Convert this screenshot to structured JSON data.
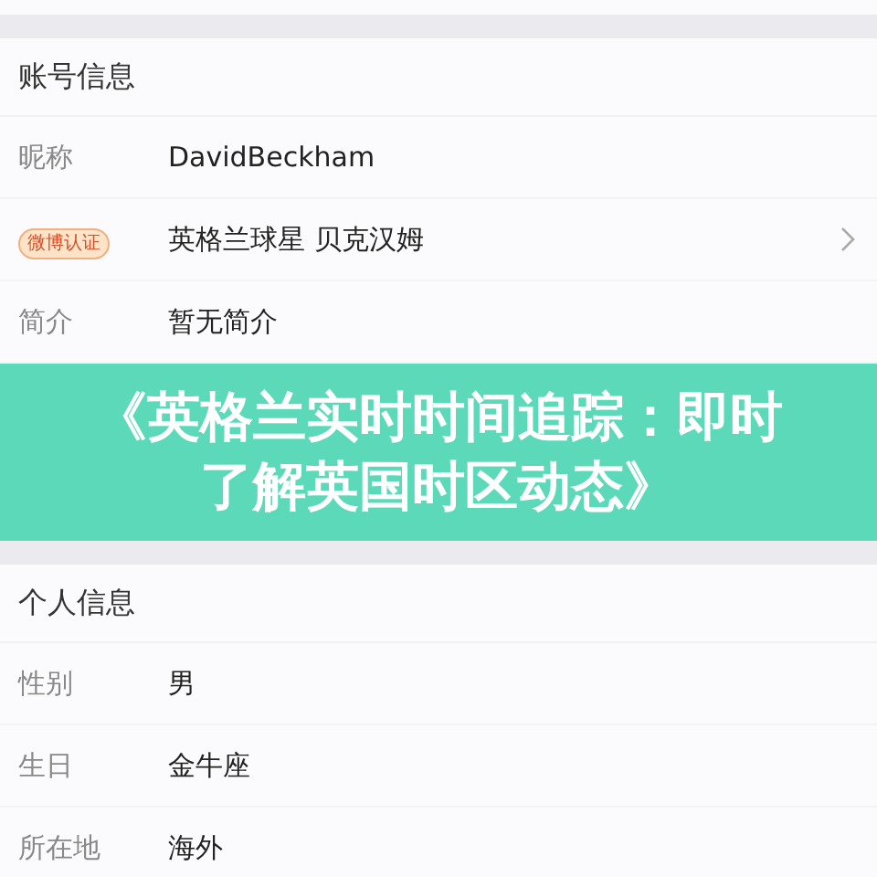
{
  "sections": [
    {
      "title": "账号信息",
      "rows": [
        {
          "label": "昵称",
          "kind": "text",
          "value": "DavidBeckham",
          "chevron": false
        },
        {
          "label": "微博认证",
          "kind": "badge",
          "value": "英格兰球星 贝克汉姆",
          "chevron": true
        },
        {
          "label": "简介",
          "kind": "text",
          "value": "暂无简介",
          "chevron": false
        }
      ]
    },
    {
      "title": "个人信息",
      "rows": [
        {
          "label": "性别",
          "kind": "text",
          "value": "男",
          "chevron": false
        },
        {
          "label": "生日",
          "kind": "text",
          "value": "金牛座",
          "chevron": false
        },
        {
          "label": "所在地",
          "kind": "text",
          "value": "海外",
          "chevron": false
        }
      ]
    }
  ],
  "banner": {
    "lines": [
      "《英格兰实时时间追踪：即时",
      "了解英国时区动态》"
    ]
  }
}
